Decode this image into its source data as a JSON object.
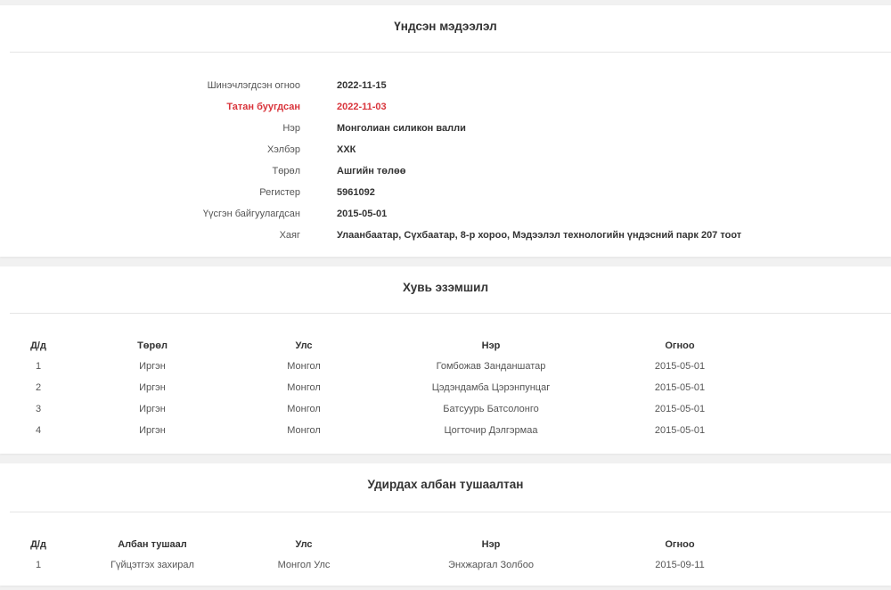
{
  "basic_info": {
    "title": "Үндсэн мэдээлэл",
    "rows": [
      {
        "label": "Шинэчлэгдсэн огноо",
        "value": "2022-11-15"
      },
      {
        "label": "Татан буугдсан",
        "value": "2022-11-03",
        "status_color": "#d9343b"
      },
      {
        "label": "Нэр",
        "value": "Монголиан силикон валли"
      },
      {
        "label": "Хэлбэр",
        "value": "ХХК"
      },
      {
        "label": "Төрөл",
        "value": "Ашгийн төлөө"
      },
      {
        "label": "Регистер",
        "value": "5961092"
      },
      {
        "label": "Үүсгэн байгуулагдсан",
        "value": "2015-05-01"
      },
      {
        "label": "Хаяг",
        "value": "Улаанбаатар, Сүхбаатар, 8-р хороо, Мэдээлэл технологийн үндэсний парк 207 тоот"
      }
    ]
  },
  "ownership": {
    "title": "Хувь эзэмшил",
    "columns": [
      "Д/д",
      "Төрөл",
      "Улс",
      "Нэр",
      "Огноо"
    ],
    "rows": [
      [
        "1",
        "Иргэн",
        "Монгол",
        "Гомбожав Занданшатар",
        "2015-05-01"
      ],
      [
        "2",
        "Иргэн",
        "Монгол",
        "Цэдэндамба Цэрэнпунцаг",
        "2015-05-01"
      ],
      [
        "3",
        "Иргэн",
        "Монгол",
        "Батсуурь Батсолонго",
        "2015-05-01"
      ],
      [
        "4",
        "Иргэн",
        "Монгол",
        "Цогточир Дэлгэрмаа",
        "2015-05-01"
      ]
    ]
  },
  "officials": {
    "title": "Удирдах албан тушаалтан",
    "columns": [
      "Д/д",
      "Албан тушаал",
      "Улс",
      "Нэр",
      "Огноо"
    ],
    "rows": [
      [
        "1",
        "Гүйцэтгэх захирал",
        "Монгол Улс",
        "Энхжаргал Золбоо",
        "2015-09-11"
      ]
    ]
  }
}
